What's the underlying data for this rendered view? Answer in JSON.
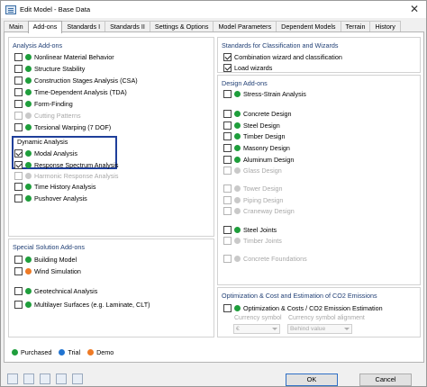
{
  "window": {
    "title": "Edit Model - Base Data",
    "close_glyph": "✕"
  },
  "tabs": [
    "Main",
    "Add-ons",
    "Standards I",
    "Standards II",
    "Settings & Options",
    "Model Parameters",
    "Dependent Models",
    "Terrain",
    "History"
  ],
  "active_tab": "Add-ons",
  "analysis_addons": {
    "title": "Analysis Add-ons",
    "items": [
      {
        "label": "Nonlinear Material Behavior",
        "checked": false,
        "dot": "green",
        "enabled": true
      },
      {
        "label": "Structure Stability",
        "checked": false,
        "dot": "green",
        "enabled": true
      },
      {
        "label": "Construction Stages Analysis (CSA)",
        "checked": false,
        "dot": "green",
        "enabled": true
      },
      {
        "label": "Time-Dependent Analysis (TDA)",
        "checked": false,
        "dot": "green",
        "enabled": true
      },
      {
        "label": "Form-Finding",
        "checked": false,
        "dot": "green",
        "enabled": true
      },
      {
        "label": "Cutting Patterns",
        "checked": false,
        "dot": "gray",
        "enabled": false
      },
      {
        "label": "Torsional Warping (7 DOF)",
        "checked": false,
        "dot": "green",
        "enabled": true
      }
    ],
    "dynamic_title": "Dynamic Analysis",
    "dynamic_items": [
      {
        "label": "Modal Analysis",
        "checked": true,
        "dot": "green",
        "enabled": true
      },
      {
        "label": "Response Spectrum Analysis",
        "checked": true,
        "dot": "green",
        "enabled": true
      },
      {
        "label": "Harmonic Response Analysis",
        "checked": false,
        "dot": "gray",
        "enabled": false
      },
      {
        "label": "Time History Analysis",
        "checked": false,
        "dot": "green",
        "enabled": true
      },
      {
        "label": "Pushover Analysis",
        "checked": false,
        "dot": "green",
        "enabled": true
      }
    ]
  },
  "special_addons": {
    "title": "Special Solution Add-ons",
    "items": [
      {
        "label": "Building Model",
        "checked": false,
        "dot": "green",
        "enabled": true
      },
      {
        "label": "Wind Simulation",
        "checked": false,
        "dot": "orange",
        "enabled": true
      },
      {
        "label": "Geotechnical Analysis",
        "checked": false,
        "dot": "green",
        "enabled": true
      },
      {
        "label": "Multilayer Surfaces (e.g. Laminate, CLT)",
        "checked": false,
        "dot": "green",
        "enabled": true
      }
    ]
  },
  "standards": {
    "title": "Standards for Classification and Wizards",
    "items": [
      {
        "label": "Combination wizard and classification",
        "checked": true
      },
      {
        "label": "Load wizards",
        "checked": true
      }
    ]
  },
  "design_addons": {
    "title": "Design Add-ons",
    "items": [
      {
        "label": "Stress-Strain Analysis",
        "checked": false,
        "dot": "green",
        "enabled": true
      },
      {
        "label": "Concrete Design",
        "checked": false,
        "dot": "green",
        "enabled": true
      },
      {
        "label": "Steel Design",
        "checked": false,
        "dot": "green",
        "enabled": true
      },
      {
        "label": "Timber Design",
        "checked": false,
        "dot": "green",
        "enabled": true
      },
      {
        "label": "Masonry Design",
        "checked": false,
        "dot": "green",
        "enabled": true
      },
      {
        "label": "Aluminum Design",
        "checked": false,
        "dot": "green",
        "enabled": true
      },
      {
        "label": "Glass Design",
        "checked": false,
        "dot": "gray",
        "enabled": false
      },
      {
        "label": "Tower Design",
        "checked": false,
        "dot": "gray",
        "enabled": false
      },
      {
        "label": "Piping Design",
        "checked": false,
        "dot": "gray",
        "enabled": false
      },
      {
        "label": "Craneway Design",
        "checked": false,
        "dot": "gray",
        "enabled": false
      },
      {
        "label": "Steel Joints",
        "checked": false,
        "dot": "green",
        "enabled": true
      },
      {
        "label": "Timber Joints",
        "checked": false,
        "dot": "gray",
        "enabled": false
      },
      {
        "label": "Concrete Foundations",
        "checked": false,
        "dot": "gray",
        "enabled": false
      }
    ]
  },
  "optimization": {
    "title": "Optimization & Cost and Estimation of CO2 Emissions",
    "item": {
      "label": "Optimization & Costs / CO2 Emission Estimation",
      "checked": false,
      "dot": "green"
    },
    "currency_symbol_label": "Currency symbol",
    "currency_symbol_value": "€",
    "alignment_label": "Currency symbol alignment",
    "alignment_value": "Behind value"
  },
  "legend": [
    {
      "label": "Purchased",
      "color": "#1f9e3c"
    },
    {
      "label": "Trial",
      "color": "#2174d1"
    },
    {
      "label": "Demo",
      "color": "#ee7a25"
    }
  ],
  "buttons": {
    "ok": "OK",
    "cancel": "Cancel"
  },
  "toolbar_icons": [
    "search-icon",
    "model-icon",
    "units-icon",
    "settings-icon",
    "export-icon"
  ]
}
